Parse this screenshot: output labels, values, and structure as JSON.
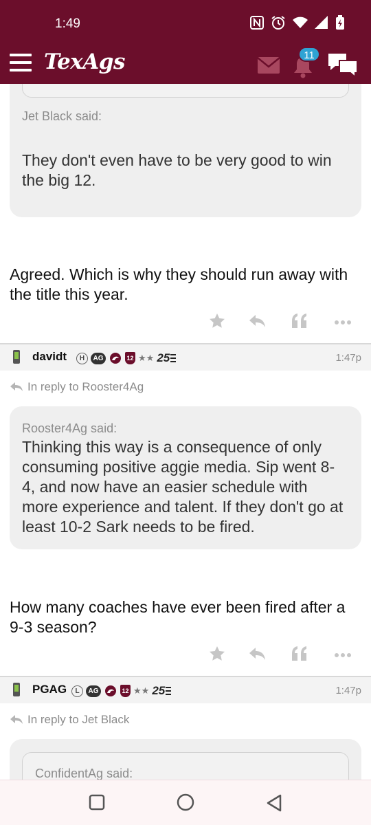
{
  "status_bar": {
    "time": "1:49"
  },
  "app_bar": {
    "logo": "TexAgs",
    "notification_count": "11"
  },
  "thread": {
    "top_fragment": {
      "quote_said": "Jet Black said:",
      "quote_text": "They don't even have to be very good to win the big 12.",
      "reply_text": "Agreed. Which is why they should run away with the title this year."
    },
    "posts": [
      {
        "username": "davidt",
        "badge_letter": "H",
        "badge_ag": "AG",
        "badge_12": "12",
        "stars": "★★",
        "badge_25": "25",
        "time": "1:47p",
        "reply_to": "In reply to Rooster4Ag",
        "quote_said": "Rooster4Ag said:",
        "quote_text": "Thinking this way is a consequence of only consuming positive aggie media. Sip went 8-4, and now have an easier schedule with more experience and talent. If they don't go at least 10-2 Sark needs to be fired.",
        "text": "How many coaches have ever been fired after a 9-3 season?"
      },
      {
        "username": "PGAG",
        "badge_letter": "L",
        "badge_ag": "AG",
        "badge_12": "12",
        "stars": "★★",
        "badge_25": "25",
        "time": "1:47p",
        "reply_to": "In reply to Jet Black",
        "quote_said": "ConfidentAg said:"
      }
    ]
  },
  "colors": {
    "brand": "#6b0e2b",
    "badge_blue": "#2fa3d4"
  }
}
